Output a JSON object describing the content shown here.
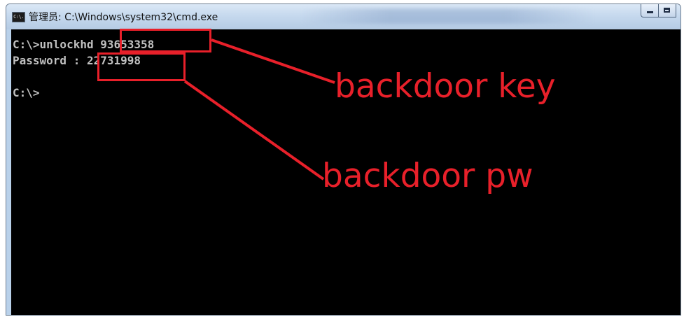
{
  "window": {
    "icon_label": "C:\\.",
    "title": "管理员: C:\\Windows\\system32\\cmd.exe"
  },
  "console": {
    "lines": [
      "C:\\>unlockhd 93653358",
      "Password : 22731998",
      "",
      "C:\\>"
    ]
  },
  "annotations": {
    "key_label": "backdoor key",
    "pw_label": "backdoor pw",
    "color": "#e8202a"
  },
  "icons": [
    "cmd-icon",
    "minimize-icon",
    "maximize-icon"
  ]
}
